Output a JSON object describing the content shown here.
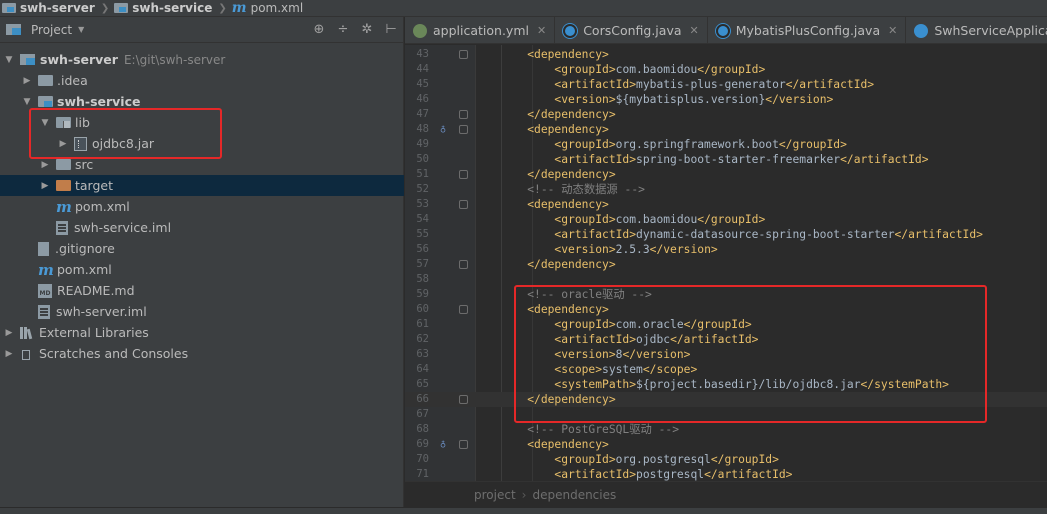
{
  "breadcrumbs": [
    "swh-server",
    "swh-service",
    "pom.xml"
  ],
  "project_panel": {
    "title": "Project",
    "tree": [
      {
        "label": "swh-server",
        "path": "E:\\git\\swh-server",
        "icon": "project-folder-icon",
        "arrow": "▼"
      },
      {
        "label": ".idea",
        "icon": "folder-icon",
        "arrow": "▶"
      },
      {
        "label": "swh-service",
        "icon": "module-folder-icon",
        "arrow": "▼"
      },
      {
        "label": "lib",
        "icon": "library-folder-icon",
        "arrow": "▼"
      },
      {
        "label": "ojdbc8.jar",
        "icon": "jar-icon",
        "arrow": "▶"
      },
      {
        "label": "src",
        "icon": "folder-icon",
        "arrow": "▶"
      },
      {
        "label": "target",
        "icon": "folder-orange-icon",
        "arrow": "▶"
      },
      {
        "label": "pom.xml",
        "icon": "maven-icon",
        "arrow": ""
      },
      {
        "label": "swh-service.iml",
        "icon": "iml-file-icon",
        "arrow": ""
      },
      {
        "label": ".gitignore",
        "icon": "gitignore-file-icon",
        "arrow": ""
      },
      {
        "label": "pom.xml",
        "icon": "maven-icon",
        "arrow": ""
      },
      {
        "label": "README.md",
        "icon": "markdown-file-icon",
        "arrow": ""
      },
      {
        "label": "swh-server.iml",
        "icon": "iml-file-icon",
        "arrow": ""
      },
      {
        "label": "External Libraries",
        "icon": "libraries-icon",
        "arrow": "▶"
      },
      {
        "label": "Scratches and Consoles",
        "icon": "scratches-icon",
        "arrow": "▶"
      }
    ]
  },
  "tabs": [
    {
      "label": "application.yml",
      "icon": "yaml-file-icon"
    },
    {
      "label": "CorsConfig.java",
      "icon": "java-class-icon"
    },
    {
      "label": "MybatisPlusConfig.java",
      "icon": "java-class-icon"
    },
    {
      "label": "SwhServiceApplication.java",
      "icon": "spring-boot-class-icon"
    }
  ],
  "code_lines": [
    {
      "n": "43",
      "indent": "    ",
      "parts": [
        [
          "tg",
          "<dependency>"
        ]
      ]
    },
    {
      "n": "44",
      "indent": "        ",
      "parts": [
        [
          "tg",
          "<groupId>"
        ],
        [
          "tx",
          "com.baomidou"
        ],
        [
          "tg",
          "</groupId>"
        ]
      ]
    },
    {
      "n": "45",
      "indent": "        ",
      "parts": [
        [
          "tg",
          "<artifactId>"
        ],
        [
          "tx",
          "mybatis-plus-generator"
        ],
        [
          "tg",
          "</artifactId>"
        ]
      ]
    },
    {
      "n": "46",
      "indent": "        ",
      "parts": [
        [
          "tg",
          "<version>"
        ],
        [
          "tx",
          "${mybatisplus.version}"
        ],
        [
          "tg",
          "</version>"
        ]
      ]
    },
    {
      "n": "47",
      "indent": "    ",
      "parts": [
        [
          "tg",
          "</dependency>"
        ]
      ]
    },
    {
      "n": "48",
      "indent": "    ",
      "parts": [
        [
          "tg",
          "<dependency>"
        ]
      ]
    },
    {
      "n": "49",
      "indent": "        ",
      "parts": [
        [
          "tg",
          "<groupId>"
        ],
        [
          "tx",
          "org.springframework.boot"
        ],
        [
          "tg",
          "</groupId>"
        ]
      ]
    },
    {
      "n": "50",
      "indent": "        ",
      "parts": [
        [
          "tg",
          "<artifactId>"
        ],
        [
          "tx",
          "spring-boot-starter-freemarker"
        ],
        [
          "tg",
          "</artifactId>"
        ]
      ]
    },
    {
      "n": "51",
      "indent": "    ",
      "parts": [
        [
          "tg",
          "</dependency>"
        ]
      ]
    },
    {
      "n": "52",
      "indent": "    ",
      "parts": [
        [
          "cm",
          "<!-- 动态数据源 -->"
        ]
      ]
    },
    {
      "n": "53",
      "indent": "    ",
      "parts": [
        [
          "tg",
          "<dependency>"
        ]
      ]
    },
    {
      "n": "54",
      "indent": "        ",
      "parts": [
        [
          "tg",
          "<groupId>"
        ],
        [
          "tx",
          "com.baomidou"
        ],
        [
          "tg",
          "</groupId>"
        ]
      ]
    },
    {
      "n": "55",
      "indent": "        ",
      "parts": [
        [
          "tg",
          "<artifactId>"
        ],
        [
          "tx",
          "dynamic-datasource-spring-boot-starter"
        ],
        [
          "tg",
          "</artifactId>"
        ]
      ]
    },
    {
      "n": "56",
      "indent": "        ",
      "parts": [
        [
          "tg",
          "<version>"
        ],
        [
          "tx",
          "2.5.3"
        ],
        [
          "tg",
          "</version>"
        ]
      ]
    },
    {
      "n": "57",
      "indent": "    ",
      "parts": [
        [
          "tg",
          "</dependency>"
        ]
      ]
    },
    {
      "n": "58",
      "indent": "",
      "parts": []
    },
    {
      "n": "59",
      "indent": "    ",
      "parts": [
        [
          "cm",
          "<!-- oracle驱动 -->"
        ]
      ]
    },
    {
      "n": "60",
      "indent": "    ",
      "parts": [
        [
          "tg",
          "<dependency>"
        ]
      ]
    },
    {
      "n": "61",
      "indent": "        ",
      "parts": [
        [
          "tg",
          "<groupId>"
        ],
        [
          "tx",
          "com.oracle"
        ],
        [
          "tg",
          "</groupId>"
        ]
      ]
    },
    {
      "n": "62",
      "indent": "        ",
      "parts": [
        [
          "tg",
          "<artifactId>"
        ],
        [
          "tx",
          "ojdbc"
        ],
        [
          "tg",
          "</artifactId>"
        ]
      ]
    },
    {
      "n": "63",
      "indent": "        ",
      "parts": [
        [
          "tg",
          "<version>"
        ],
        [
          "tx",
          "8"
        ],
        [
          "tg",
          "</version>"
        ]
      ]
    },
    {
      "n": "64",
      "indent": "        ",
      "parts": [
        [
          "tg",
          "<scope>"
        ],
        [
          "tx",
          "system"
        ],
        [
          "tg",
          "</scope>"
        ]
      ]
    },
    {
      "n": "65",
      "indent": "        ",
      "parts": [
        [
          "tg",
          "<systemPath>"
        ],
        [
          "tx",
          "${project.basedir}/lib/ojdbc8.jar"
        ],
        [
          "tg",
          "</systemPath>"
        ]
      ]
    },
    {
      "n": "66",
      "indent": "    ",
      "parts": [
        [
          "tg",
          "</dependency>"
        ]
      ]
    },
    {
      "n": "67",
      "indent": "",
      "parts": []
    },
    {
      "n": "68",
      "indent": "    ",
      "parts": [
        [
          "cm",
          "<!-- PostGreSQL驱动 -->"
        ]
      ]
    },
    {
      "n": "69",
      "indent": "    ",
      "parts": [
        [
          "tg",
          "<dependency>"
        ]
      ]
    },
    {
      "n": "70",
      "indent": "        ",
      "parts": [
        [
          "tg",
          "<groupId>"
        ],
        [
          "tx",
          "org.postgresql"
        ],
        [
          "tg",
          "</groupId>"
        ]
      ]
    },
    {
      "n": "71",
      "indent": "        ",
      "parts": [
        [
          "tg",
          "<artifactId>"
        ],
        [
          "tx",
          "postgresql"
        ],
        [
          "tg",
          "</artifactId>"
        ]
      ]
    }
  ],
  "editor_breadcrumb": [
    "project",
    "dependencies"
  ],
  "colors": {
    "highlight": "#e52828",
    "tag": "#e8bf6a",
    "comment": "#808080",
    "text": "#a9b7c6"
  }
}
